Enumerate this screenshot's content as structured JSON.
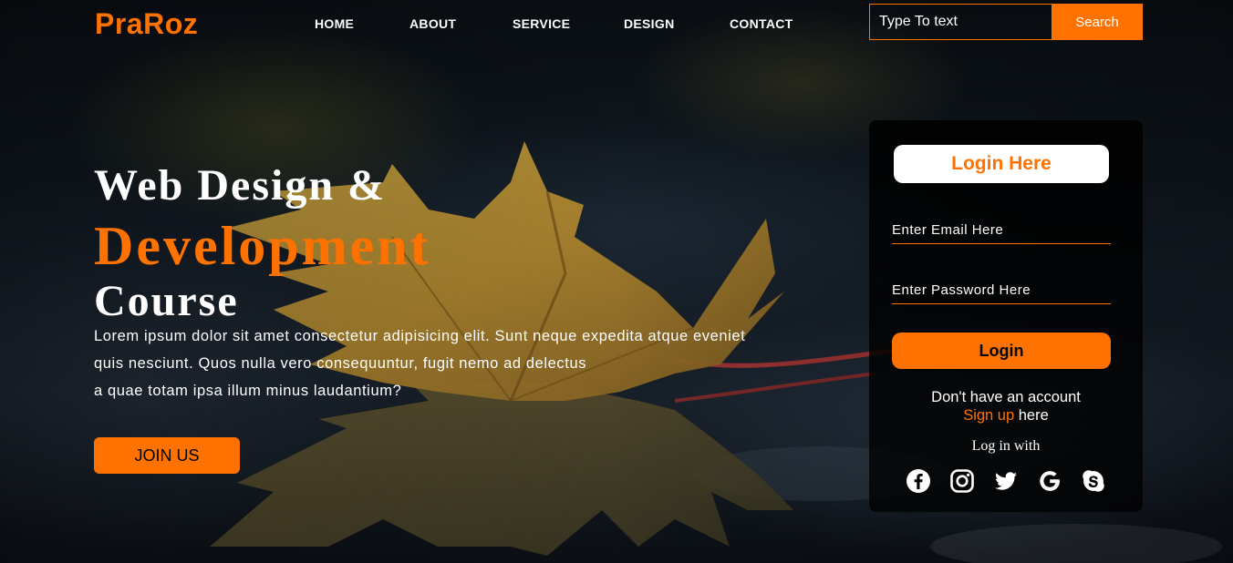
{
  "brand": {
    "logo": "PraRoz",
    "accent_color": "#ff7200"
  },
  "nav": {
    "items": [
      {
        "label": "HOME"
      },
      {
        "label": "ABOUT"
      },
      {
        "label": "SERVICE"
      },
      {
        "label": "DESIGN"
      },
      {
        "label": "CONTACT"
      }
    ]
  },
  "search": {
    "placeholder": "Type To text",
    "button_label": "Search"
  },
  "hero": {
    "title_line1": "Web Design &",
    "title_line2": "Development",
    "title_line3": "Course",
    "paragraph_line1": "Lorem ipsum dolor sit amet consectetur adipisicing elit. Sunt neque expedita atque eveniet",
    "paragraph_line2": "quis nesciunt. Quos nulla vero consequuntur, fugit nemo ad delectus",
    "paragraph_line3": "a quae totam ipsa illum minus laudantium?",
    "join_label": "JOIN US"
  },
  "login_form": {
    "heading": "Login Here",
    "email_placeholder": "Enter Email Here",
    "password_placeholder": "Enter Password Here",
    "login_label": "Login",
    "no_account_text": "Don't have an account",
    "signup_link": "Sign up",
    "signup_suffix": " here",
    "login_with": "Log in with",
    "social_icons": [
      "facebook-icon",
      "instagram-icon",
      "twitter-icon",
      "google-icon",
      "skype-icon"
    ]
  }
}
